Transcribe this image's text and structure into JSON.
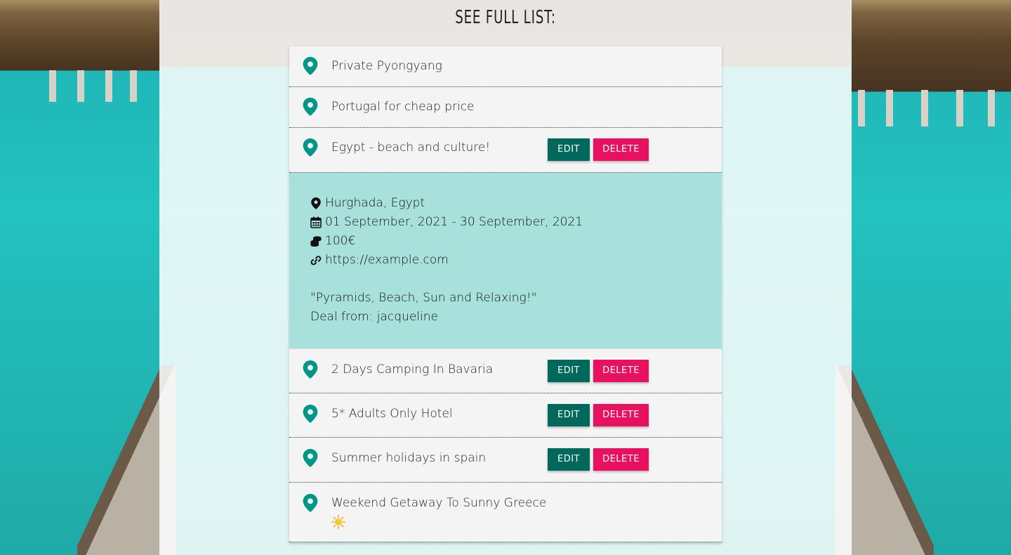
{
  "page": {
    "title": "SEE FULL LIST:"
  },
  "deals": [
    {
      "title": "Private Pyongyang"
    },
    {
      "title": "Portugal for cheap price"
    },
    {
      "title": "Egypt - beach and culture!",
      "edit_label": "EDIT",
      "delete_label": "DELETE"
    },
    {
      "title": "2 Days Camping In Bavaria",
      "edit_label": "EDIT",
      "delete_label": "DELETE"
    },
    {
      "title": "5* Adults Only Hotel",
      "edit_label": "EDIT",
      "delete_label": "DELETE"
    },
    {
      "title": "Summer holidays in spain",
      "edit_label": "EDIT",
      "delete_label": "DELETE"
    },
    {
      "title": "Weekend Getaway To Sunny Greece",
      "emoji": "sun-emoji"
    }
  ],
  "expanded": {
    "location": "Hurghada, Egypt",
    "dates": "01 September, 2021 - 30 September, 2021",
    "price": "100€",
    "url": "https://example.com",
    "quote": "\"Pyramids, Beach, Sun and Relaxing!\"",
    "author": "Deal from: jacqueline"
  },
  "colors": {
    "accent": "#009688",
    "edit": "#00695c",
    "delete": "#e8115f",
    "details_bg": "#a8e1dc"
  },
  "icons": [
    "map-marker-icon",
    "calendar-icon",
    "coins-icon",
    "link-icon"
  ]
}
